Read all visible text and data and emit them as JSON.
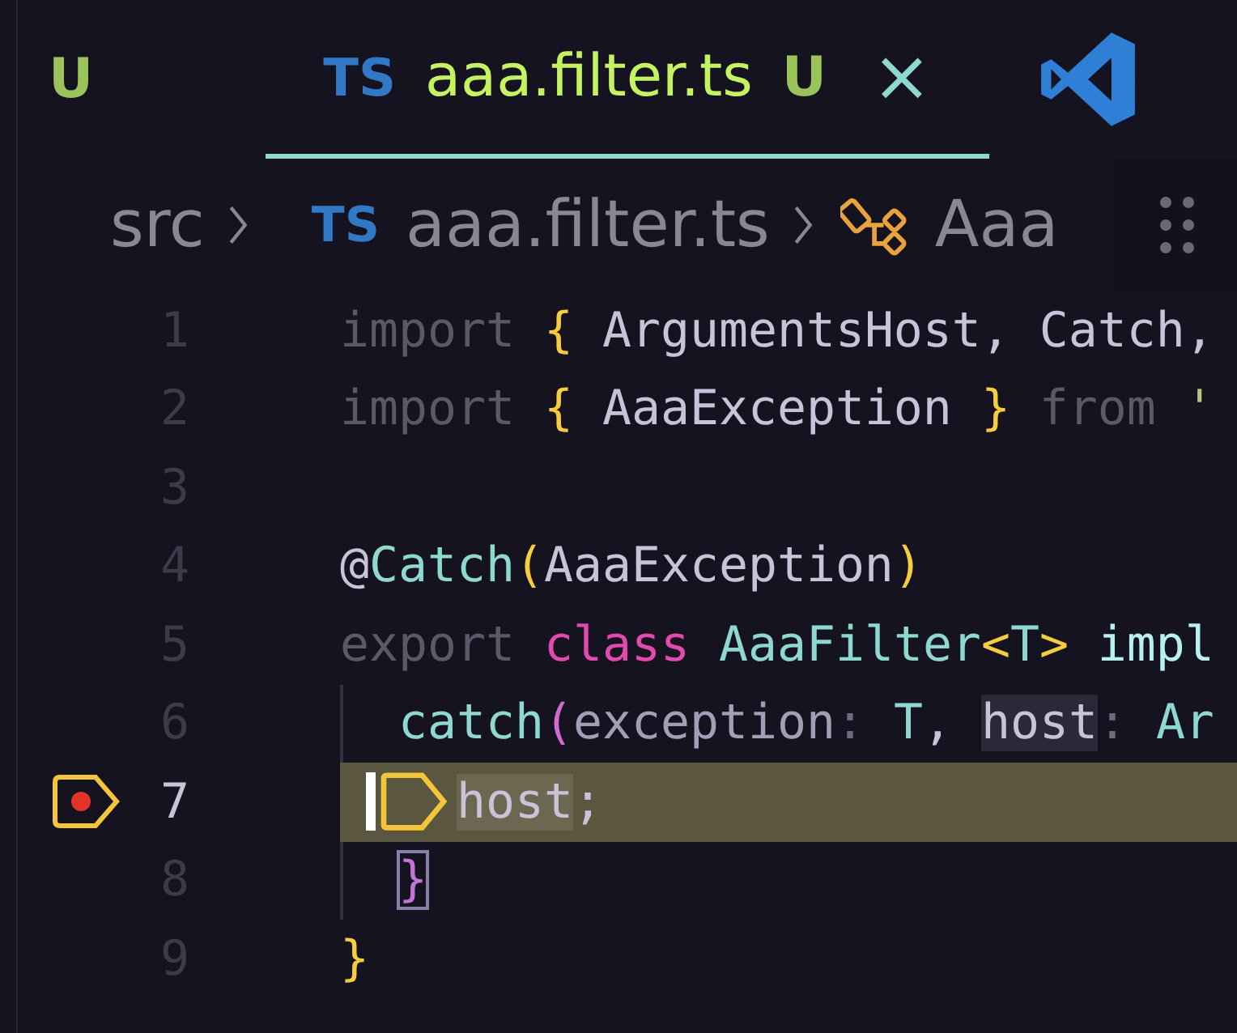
{
  "tabs": [
    {
      "status": "U",
      "selected": false
    },
    {
      "icon_text": "TS",
      "label": "aaa.filter.ts",
      "status": "U",
      "close": "×",
      "selected": true
    }
  ],
  "breadcrumb": {
    "folder": "src",
    "file_icon_text": "TS",
    "file": "aaa.filter.ts",
    "symbol": "Aaa"
  },
  "code_lines": [
    {
      "number": "1",
      "current": false,
      "breakpoint": false,
      "tokens": [
        {
          "kind": "keyword-dim",
          "text": "import "
        },
        {
          "kind": "brace",
          "text": "{"
        },
        {
          "kind": "ident",
          "text": " ArgumentsHost, Catch,"
        }
      ]
    },
    {
      "number": "2",
      "current": false,
      "breakpoint": false,
      "tokens": [
        {
          "kind": "keyword-dim",
          "text": "import "
        },
        {
          "kind": "brace",
          "text": "{"
        },
        {
          "kind": "ident",
          "text": " AaaException "
        },
        {
          "kind": "brace",
          "text": "}"
        },
        {
          "kind": "keyword-dim",
          "text": " from "
        },
        {
          "kind": "string",
          "text": "'"
        }
      ]
    },
    {
      "number": "3",
      "current": false,
      "breakpoint": false
    },
    {
      "number": "4",
      "current": false,
      "breakpoint": false,
      "tokens": [
        {
          "kind": "ident",
          "text": "@"
        },
        {
          "kind": "func",
          "text": "Catch"
        },
        {
          "kind": "brace",
          "text": "("
        },
        {
          "kind": "ident",
          "text": "AaaException"
        },
        {
          "kind": "brace",
          "text": ")"
        }
      ]
    },
    {
      "number": "5",
      "current": false,
      "breakpoint": false,
      "tokens": [
        {
          "kind": "keyword-dim",
          "text": "export "
        },
        {
          "kind": "keyword",
          "text": "class "
        },
        {
          "kind": "func",
          "text": "AaaFilter"
        },
        {
          "kind": "brace",
          "text": "<"
        },
        {
          "kind": "func",
          "text": "T"
        },
        {
          "kind": "brace",
          "text": ">"
        },
        {
          "kind": "type",
          "text": " impl"
        }
      ],
      "children": [
        {
          "number": "6",
          "current": false,
          "breakpoint": false,
          "tokens": [
            {
              "kind": "func",
              "text": "catch"
            },
            {
              "kind": "paren",
              "text": "("
            },
            {
              "kind": "param",
              "text": "exception"
            },
            {
              "kind": "param-dim",
              "text": ": "
            },
            {
              "kind": "func",
              "text": "T"
            },
            {
              "kind": "ident",
              "text": ", "
            },
            {
              "kind": "param-hl",
              "text": "host"
            },
            {
              "kind": "param-dim",
              "text": ": "
            },
            {
              "kind": "func",
              "text": "Ar"
            }
          ],
          "children": [
            {
              "number": "7",
              "current": true,
              "breakpoint": true,
              "tokens": [
                {
                  "kind": "ident-hl",
                  "text": "host"
                },
                {
                  "kind": "ident",
                  "text": ";"
                }
              ]
            }
          ]
        },
        {
          "number": "8",
          "current": false,
          "breakpoint": false,
          "tokens": [
            {
              "kind": "paren-match",
              "text": "}"
            }
          ]
        }
      ]
    },
    {
      "number": "9",
      "current": false,
      "breakpoint": false,
      "tokens": [
        {
          "kind": "brace",
          "text": "}"
        }
      ]
    }
  ]
}
